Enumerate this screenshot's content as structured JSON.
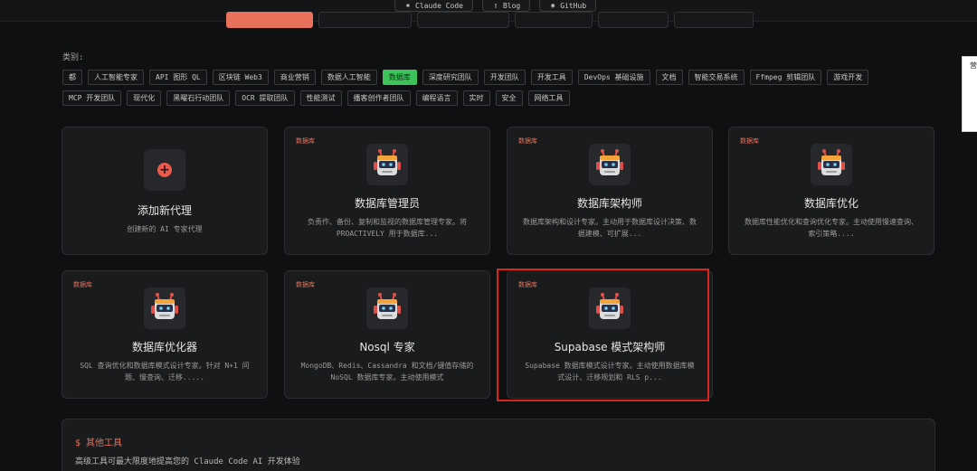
{
  "topnav": [
    {
      "label": "Claude Code",
      "icon": "claude-icon"
    },
    {
      "label": "Blog",
      "icon": "document-icon"
    },
    {
      "label": "GitHub",
      "icon": "github-icon"
    }
  ],
  "category": {
    "label": "类别:",
    "tags_row1": [
      "都",
      "人工智能专家",
      "API 图形 QL",
      "区块链 Web3",
      "商业营销",
      "数据人工智能",
      "数据库",
      "深度研究团队",
      "开发团队",
      "开发工具",
      "DevOps 基础设施",
      "文档",
      "智能交易系统",
      "Ffmpeg 剪辑团队",
      "游戏开发"
    ],
    "tags_row2": [
      "MCP 开发团队",
      "现代化",
      "黑曜石行动团队",
      "OCR 提取团队",
      "性能测试",
      "播客创作者团队",
      "编程语言",
      "实时",
      "安全",
      "网络工具"
    ],
    "active_tag": "数据库"
  },
  "add_card": {
    "title": "添加新代理",
    "desc": "创建新的 AI 专家代理"
  },
  "cards": [
    {
      "badge": "数据库",
      "title": "数据库管理员",
      "desc": "负责作、备份、复制和监视的数据库管理专家。将 PROACTIVELY 用于数据库..."
    },
    {
      "badge": "数据库",
      "title": "数据库架构师",
      "desc": "数据库架构和设计专家。主动用于数据库设计决策、数据建模、可扩展..."
    },
    {
      "badge": "数据库",
      "title": "数据库优化",
      "desc": "数据库性能优化和查询优化专家。主动使用慢速查询、索引策略...."
    },
    {
      "badge": "数据库",
      "title": "数据库优化器",
      "desc": "SQL 查询优化和数据库模式设计专家。针对 N+1 问题、慢查询、迁移....."
    },
    {
      "badge": "数据库",
      "title": "Nosql 专家",
      "desc": "MongoDB、Redis、Cassandra 和文档/键值存储的 NoSQL 数据库专家。主动使用模式"
    },
    {
      "badge": "数据库",
      "title": "Supabase 模式架构师",
      "desc": "Supabase 数据库模式设计专家。主动使用数据库模式设计、迁移规划和 RLS p..."
    }
  ],
  "tools": {
    "title": "$ 其他工具",
    "desc": "高级工具可最大限度地提高您的 Claude Code AI 开发体验"
  },
  "side_panel": {
    "text": "营"
  },
  "colors": {
    "accent": "#e8715b",
    "active_tag": "#3ec35a",
    "highlight": "#d9261c"
  }
}
